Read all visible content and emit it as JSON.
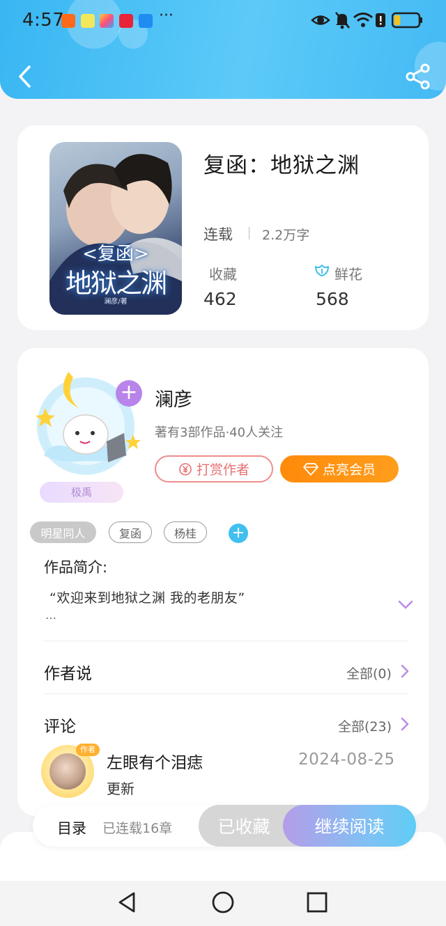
{
  "status_bar": {
    "time": "4:57",
    "more_apps": "···",
    "battery_level": 0.25
  },
  "header": {
    "back_icon": "chevron-left-icon",
    "share_icon": "share-icon"
  },
  "book": {
    "title": "复函：地狱之渊",
    "status": "连载",
    "word_count": "2.2万字",
    "favorites_label": "收藏",
    "favorites_count": "462",
    "flowers_label": "鲜花",
    "flowers_count": "568",
    "cover": {
      "title_top": "<复函>",
      "title_main": "地狱之渊",
      "author_line": "澜彦/著"
    }
  },
  "author": {
    "name": "澜彦",
    "meta": "著有3部作品·40人关注",
    "badge": "极禹",
    "tip_button": "打赏作者",
    "vip_button": "点亮会员",
    "follow_icon": "plus-icon"
  },
  "tags": [
    {
      "label": "明星同人"
    },
    {
      "label": "复函"
    },
    {
      "label": "杨桂"
    }
  ],
  "intro": {
    "title": "作品简介:",
    "text": "“欢迎来到地狱之渊 我的老朋友”",
    "ellipsis": "…"
  },
  "author_says": {
    "title": "作者说",
    "link": "全部(0)"
  },
  "comments": {
    "title": "评论",
    "link": "全部(23)",
    "items": [
      {
        "user": "左眼有个泪痣",
        "badge": "作者",
        "date": "2024-08-25",
        "text": "更新"
      }
    ]
  },
  "bottom_bar": {
    "toc_label": "目录",
    "toc_count": "已连载16章",
    "collected_button": "已收藏",
    "read_button": "继续阅读"
  },
  "colors": {
    "header_blue": "#3db8f3",
    "vip_orange": "#ff9012",
    "tip_red": "#e67070",
    "tag_add_blue": "#41c0f0",
    "chevron_purple": "#b98ce6"
  }
}
